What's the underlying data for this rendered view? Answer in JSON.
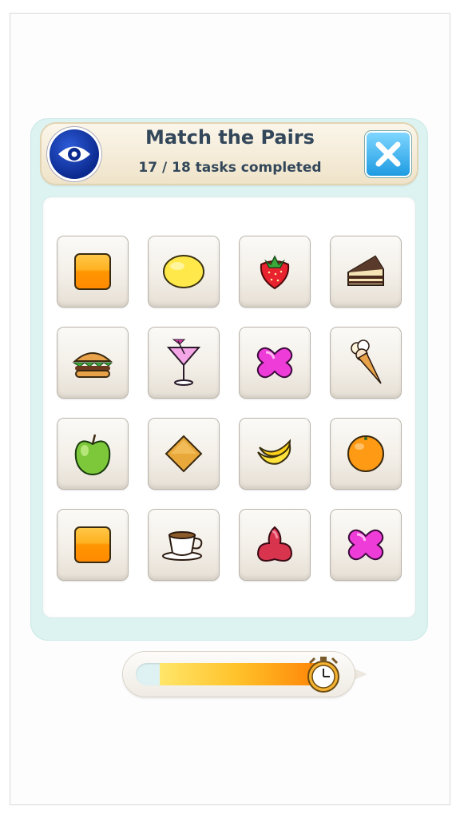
{
  "header": {
    "title": "Match the Pairs",
    "progress_text": "17 / 18 tasks completed",
    "eye_icon": "eye-icon",
    "close_icon": "close-icon"
  },
  "colors": {
    "panel": "#ddf3f1",
    "header_text": "#33475a",
    "close_button": "#1e9be2",
    "eye_button": "#0b2a8f",
    "timer_fill": "#ffb020"
  },
  "board": {
    "rows": [
      [
        "orange-square",
        "lemon",
        "strawberry",
        "cake-slice"
      ],
      [
        "burger",
        "cocktail",
        "pink-butterfly",
        "ice-cream-cone"
      ],
      [
        "green-apple",
        "orange-diamond",
        "banana",
        "orange"
      ],
      [
        "orange-square",
        "coffee-cup",
        "red-trefoil",
        "pink-butterfly"
      ]
    ]
  },
  "timer": {
    "icon": "alarm-clock-icon",
    "remaining_fraction": 0.88
  }
}
